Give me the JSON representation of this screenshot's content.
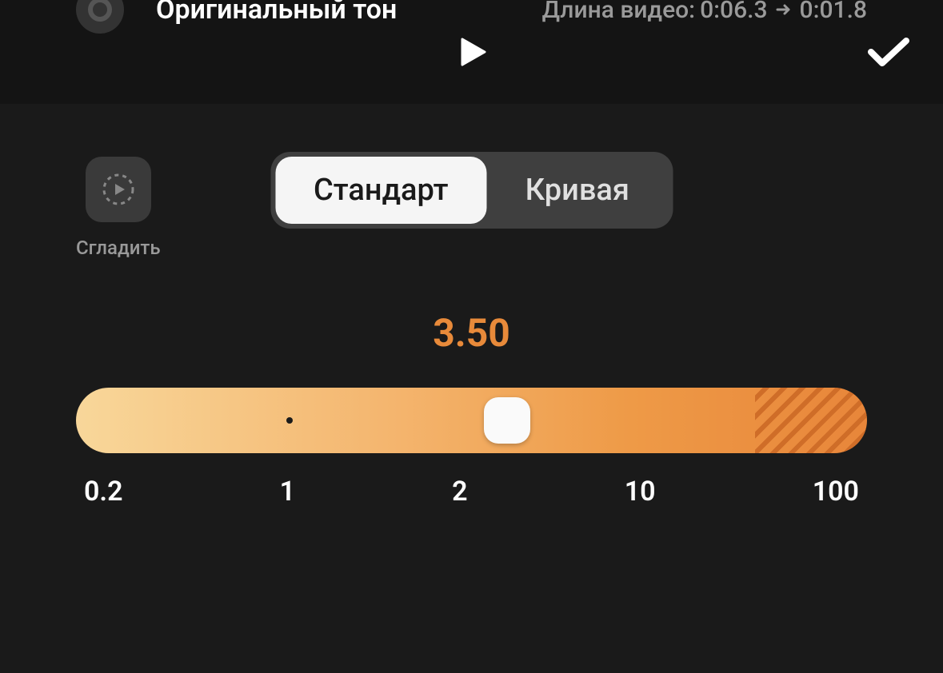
{
  "topbar": {},
  "smooth": {
    "label": "Сгладить"
  },
  "tabs": {
    "standard": "Стандарт",
    "curve": "Кривая",
    "active": "standard"
  },
  "speed": {
    "value": "3.50",
    "ticks": [
      "0.2",
      "1",
      "2",
      "10",
      "100"
    ]
  },
  "tone": {
    "label": "Оригинальный тон"
  },
  "duration": {
    "prefix": "Длина видео:",
    "from": "0:06.3",
    "to": "0:01.8"
  }
}
